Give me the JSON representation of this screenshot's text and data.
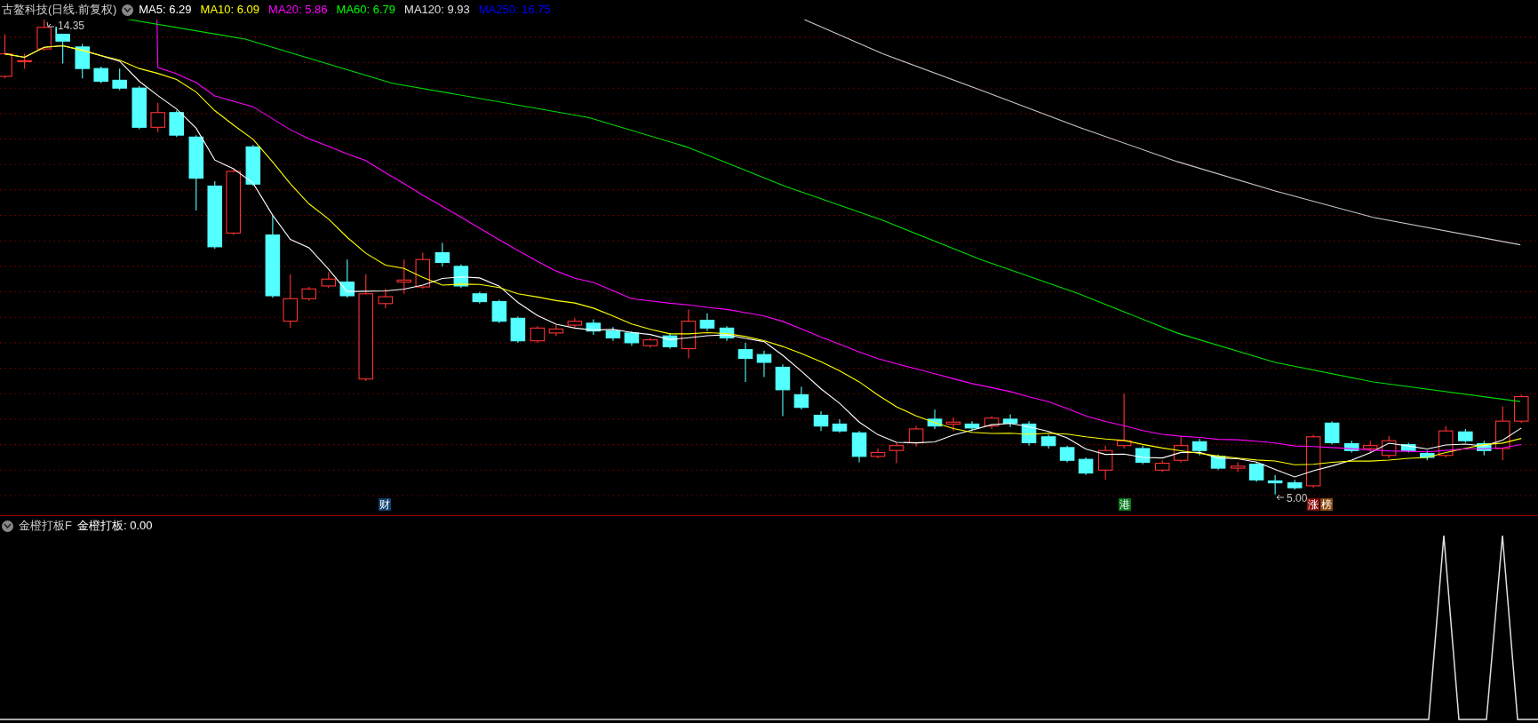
{
  "main_panel": {
    "title": "古鳌科技(日线.前复权)",
    "ma_legend": [
      {
        "label": "MA5: 6.29",
        "color": "#ffffff"
      },
      {
        "label": "MA10: 6.09",
        "color": "#ffff00"
      },
      {
        "label": "MA20: 5.86",
        "color": "#ff00ff"
      },
      {
        "label": "MA60: 6.79",
        "color": "#00ff00"
      },
      {
        "label": "MA120: 9.93",
        "color": "#e0e0e0"
      },
      {
        "label": "MA250: 16.75",
        "color": "#0000ff"
      }
    ],
    "high_label": "14.35",
    "low_label": "5.00",
    "markers": [
      {
        "text": "财",
        "color": "#0f3f6e"
      },
      {
        "text": "港",
        "color": "#0a7a1a"
      },
      {
        "text": "涨",
        "color": "#8a0c0c"
      },
      {
        "text": "榜",
        "color": "#8a4a10"
      }
    ]
  },
  "indicator_panel": {
    "title": "金橙打板F",
    "reading": "金橙打板: 0.00"
  }
}
